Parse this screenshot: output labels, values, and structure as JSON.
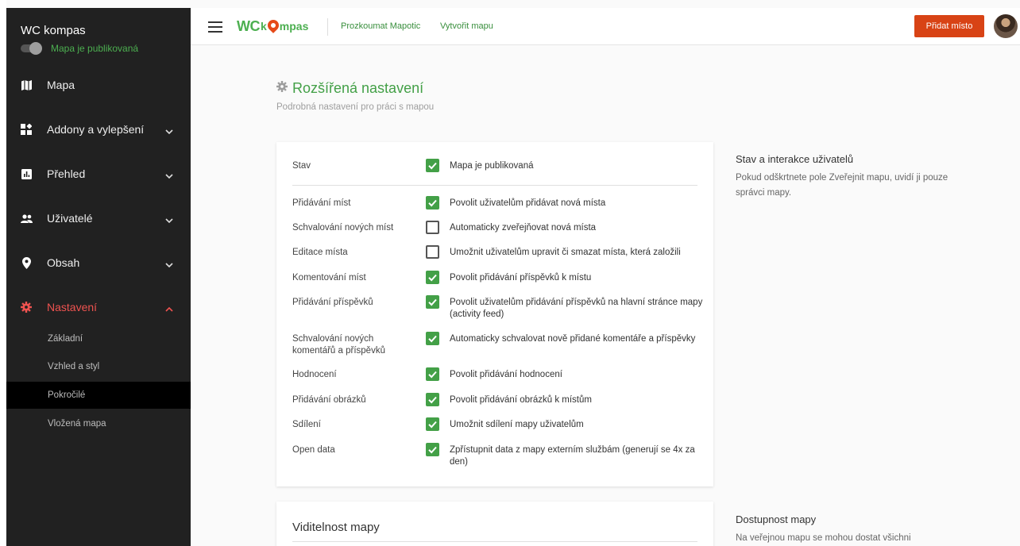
{
  "sidebar": {
    "title": "WC kompas",
    "published_label": "Mapa je publikovaná",
    "items": [
      {
        "label": "Mapa"
      },
      {
        "label": "Addony a vylepšení"
      },
      {
        "label": "Přehled"
      },
      {
        "label": "Uživatelé"
      },
      {
        "label": "Obsah"
      },
      {
        "label": "Nastavení"
      }
    ],
    "sub_items": [
      {
        "label": "Základní"
      },
      {
        "label": "Vzhled a styl"
      },
      {
        "label": "Pokročilé"
      },
      {
        "label": "Vložená mapa"
      }
    ],
    "active_item": "Nastavení",
    "active_sub_item": "Pokročilé"
  },
  "topbar": {
    "logo_wc": "WC",
    "logo_k": "k",
    "logo_mpas": "mpas",
    "links": [
      "Prozkoumat Mapotic",
      "Vytvořit mapu"
    ],
    "add_button": "Přidat místo"
  },
  "main": {
    "title": "Rozšířená nastavení",
    "subtitle": "Podrobná nastavení pro práci s mapou"
  },
  "settings": [
    {
      "label": "Stav",
      "checked": true,
      "text": "Mapa je publikovaná"
    },
    {
      "label": "Přidávání míst",
      "checked": true,
      "text": "Povolit uživatelům přidávat nová místa"
    },
    {
      "label": "Schvalování nových míst",
      "checked": false,
      "text": "Automaticky zveřejňovat nová místa"
    },
    {
      "label": "Editace místa",
      "checked": false,
      "text": "Umožnit uživatelům upravit či smazat místa, která založili"
    },
    {
      "label": "Komentování míst",
      "checked": true,
      "text": "Povolit přidávání příspěvků k místu"
    },
    {
      "label": "Přidávání příspěvků",
      "checked": true,
      "text": "Povolit uživatelům přidávání příspěvků na hlavní stránce mapy (activity feed)"
    },
    {
      "label": "Schvalování nových komentářů a příspěvků",
      "checked": true,
      "text": "Automaticky schvalovat nově přidané komentáře a příspěvky"
    },
    {
      "label": "Hodnocení",
      "checked": true,
      "text": "Povolit přidávání hodnocení"
    },
    {
      "label": "Přidávání obrázků",
      "checked": true,
      "text": "Povolit přidávání obrázků k místům"
    },
    {
      "label": "Sdílení",
      "checked": true,
      "text": "Umožnit sdílení mapy uživatelům"
    },
    {
      "label": "Open data",
      "checked": true,
      "text": "Zpřístupnit data z mapy externím službám (generují se 4x za den)"
    }
  ],
  "aside1": {
    "title": "Stav a interakce uživatelů",
    "text": "Pokud odškrtnete pole Zveřejnit mapu, uvidí ji pouze správci mapy."
  },
  "card2": {
    "title": "Viditelnost mapy"
  },
  "aside2": {
    "title": "Dostupnost mapy",
    "text": "Na veřejnou mapu se mohou dostat všichni"
  },
  "colors": {
    "sidebar_bg": "#212121",
    "accent_green": "#43a047",
    "active_red": "#ef5350",
    "button_orange": "#d84315"
  }
}
